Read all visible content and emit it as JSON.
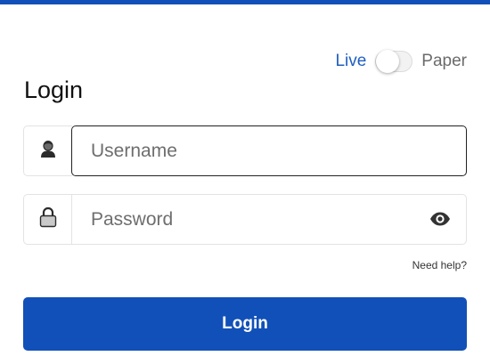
{
  "mode": {
    "live_label": "Live",
    "paper_label": "Paper",
    "selected": "Live"
  },
  "page": {
    "title": "Login"
  },
  "username": {
    "placeholder": "Username",
    "value": "",
    "icon": "user-icon"
  },
  "password": {
    "placeholder": "Password",
    "value": "",
    "icon": "lock-icon",
    "toggle_icon": "eye-icon"
  },
  "help": {
    "label": "Need help?"
  },
  "login_button": {
    "label": "Login"
  },
  "colors": {
    "primary": "#1150b8",
    "live_text": "#1f5fbf",
    "paper_text": "#6b6b6b"
  }
}
